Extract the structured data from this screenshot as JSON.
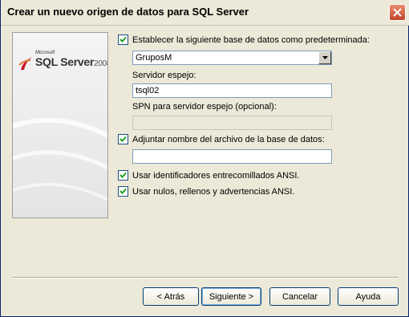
{
  "window": {
    "title": "Crear un nuevo origen de datos para SQL Server"
  },
  "icons": {
    "close": "close-icon",
    "checkbox_checked": "checkmark-icon",
    "dropdown": "chevron-down-icon"
  },
  "logo": {
    "vendor": "Microsoft",
    "product": "SQL Server",
    "version": "2008"
  },
  "form": {
    "default_db_checkbox": {
      "label": "Establecer la siguiente base de datos como predeterminada:",
      "checked": true
    },
    "database_select": {
      "value": "GruposM"
    },
    "mirror_server_label": "Servidor espejo:",
    "mirror_server_value": "tsql02",
    "spn_label": "SPN para servidor espejo (opcional):",
    "spn_value": "",
    "attach_checkbox": {
      "label": "Adjuntar nombre del archivo de la base de datos:",
      "checked": true
    },
    "attach_value": "",
    "quoted_ids_checkbox": {
      "label": "Usar identificadores entrecomillados ANSI.",
      "checked": true
    },
    "ansi_nulls_checkbox": {
      "label": "Usar nulos, rellenos y advertencias ANSI.",
      "checked": true
    }
  },
  "buttons": {
    "back": "< Atrás",
    "next": "Siguiente >",
    "cancel": "Cancelar",
    "help": "Ayuda"
  },
  "colors": {
    "titlebar_bg": "#ece9d8",
    "dialog_bg": "#ece9d8",
    "close_button": "#c1442a",
    "button_border": "#003c74"
  }
}
